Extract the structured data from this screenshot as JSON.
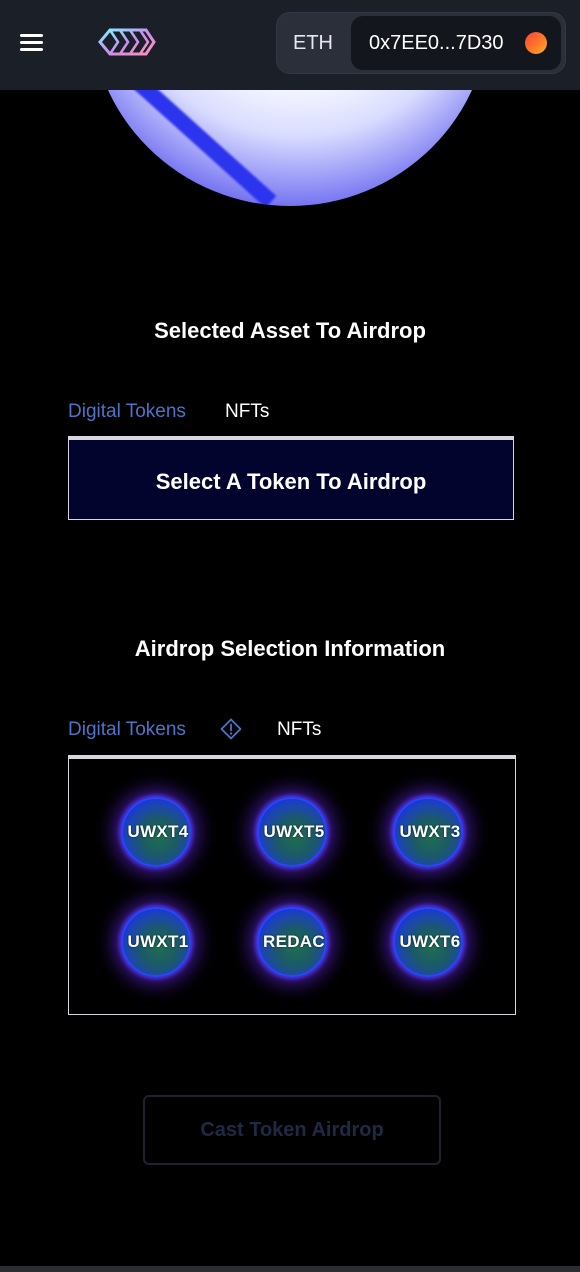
{
  "header": {
    "chain": "ETH",
    "address": "0x7EE0...7D30"
  },
  "asset_section": {
    "title": "Selected Asset To Airdrop",
    "tabs": [
      {
        "label": "Digital Tokens",
        "active": true
      },
      {
        "label": "NFTs",
        "active": false
      }
    ],
    "select_label": "Select A Token To Airdrop"
  },
  "info_section": {
    "title": "Airdrop Selection Information",
    "tabs": [
      {
        "label": "Digital Tokens",
        "active": true
      },
      {
        "label": "NFTs",
        "active": false
      }
    ],
    "tokens": [
      "UWXT4",
      "UWXT5",
      "UWXT3",
      "UWXT1",
      "REDAC",
      "UWXT6"
    ]
  },
  "cast_button": {
    "label": "Cast Token Airdrop"
  },
  "colors": {
    "active_tab": "#4d74c7",
    "select_bg": "#03042d",
    "topbar_bg": "#1b1f27"
  },
  "icons": [
    "hamburger-menu-icon",
    "brand-logo-icon",
    "wallet-avatar-icon",
    "info-diamond-icon"
  ]
}
